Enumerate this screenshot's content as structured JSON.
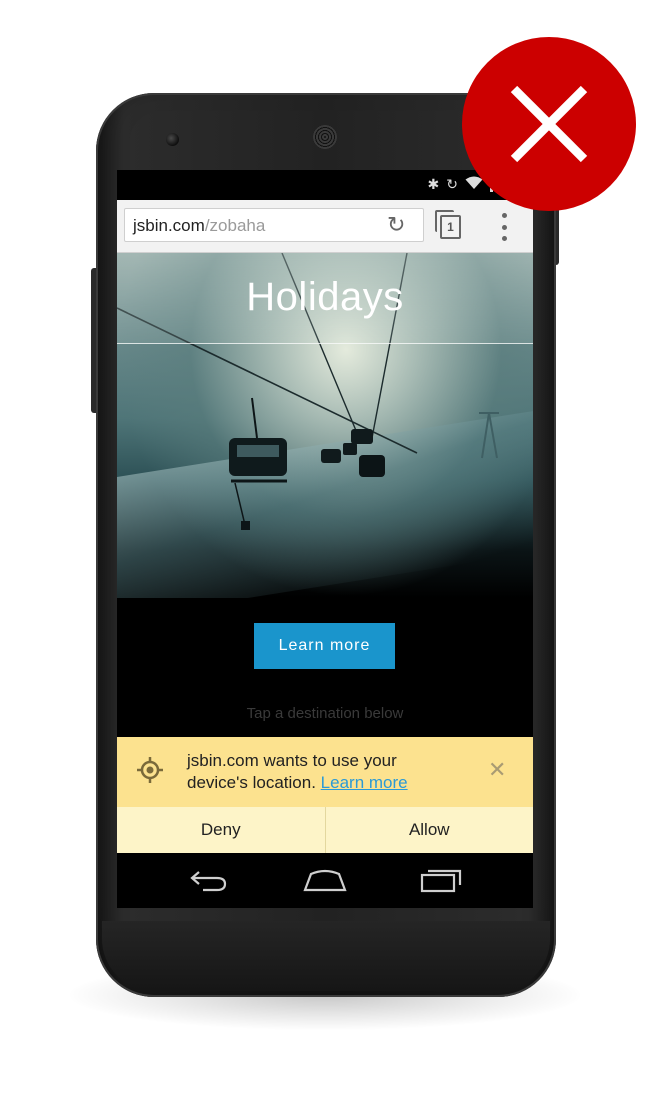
{
  "browser": {
    "url_host": "jsbin.com",
    "url_path": "/zobaha",
    "tab_count": "1",
    "reload_icon": "reload-icon",
    "menu_icon": "overflow-menu-icon"
  },
  "status_bar": {
    "icons": [
      "bluetooth-icon",
      "rotation-lock-icon",
      "wifi-icon",
      "cell-signal-icon",
      "battery-icon"
    ]
  },
  "page": {
    "title": "Holidays",
    "cta_label": "Learn more",
    "hint": "Tap a destination below"
  },
  "infobar": {
    "message_line1": "jsbin.com wants to use your",
    "message_line2": "device's location.",
    "link": "Learn more",
    "deny_label": "Deny",
    "allow_label": "Allow",
    "icon": "location-icon",
    "close_icon": "close-icon",
    "background_color": "#fce28f"
  },
  "navbar": {
    "icons": [
      "back-icon",
      "home-icon",
      "recents-icon"
    ]
  },
  "badge": {
    "icon": "do-not-icon",
    "color": "#cc0000"
  },
  "colors": {
    "accent": "#1a95cc"
  }
}
